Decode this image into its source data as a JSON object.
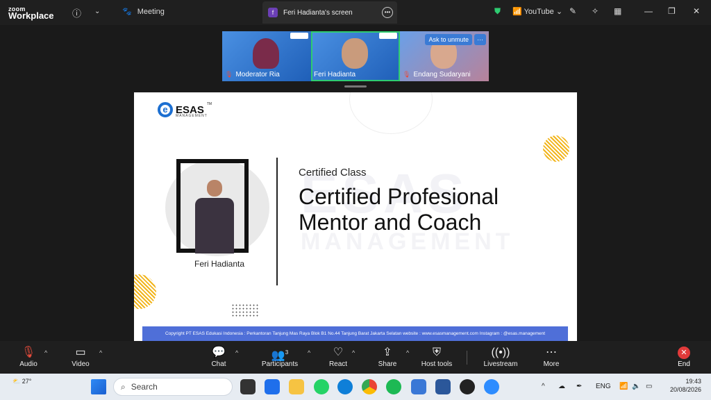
{
  "app": {
    "brand_top": "zoom",
    "brand_bottom": "Workplace",
    "meeting_label": "Meeting"
  },
  "tab": {
    "letter": "f",
    "title": "Feri Hadianta's screen"
  },
  "titlebar_right": {
    "youtube_label": "YouTube"
  },
  "participants_strip": [
    {
      "name": "Moderator Ria"
    },
    {
      "name": "Feri Hadianta"
    },
    {
      "name": "Endang Sudaryani",
      "overlay": "Ask to unmute",
      "more": "···"
    }
  ],
  "slide": {
    "logo_text": "ESAS",
    "logo_tm": "TM",
    "logo_sub": "MANAGEMENT",
    "presenter": "Feri Hadianta",
    "kicker": "Certified Class",
    "title_line1": "Certified Profesional",
    "title_line2": "Mentor and Coach",
    "watermark": "ESAS",
    "watermark2": "MANAGEMENT",
    "footer": "Copyright PT ESAS Edukasi Indonesia : Perkantoran Tanjung Mas Raya Blok B1 No.44 Tanjung Barat Jakarta Selatan website : www.esasmanagement.com Instagram : @esas.management"
  },
  "controls": {
    "audio": "Audio",
    "video": "Video",
    "chat": "Chat",
    "participants": "Participants",
    "participants_count": "3",
    "react": "React",
    "share": "Share",
    "host_tools": "Host tools",
    "livestream": "Livestream",
    "more": "More",
    "end": "End"
  },
  "taskbar": {
    "weather_temp": "27°",
    "search_placeholder": "Search",
    "language": "ENG",
    "time": "19:43",
    "date": "20/08/2026"
  },
  "colors": {
    "accent_green": "#2ecc71",
    "end_red": "#e23a3a",
    "slide_footer": "#4f6fd8",
    "brand_blue": "#1c6fd1"
  }
}
